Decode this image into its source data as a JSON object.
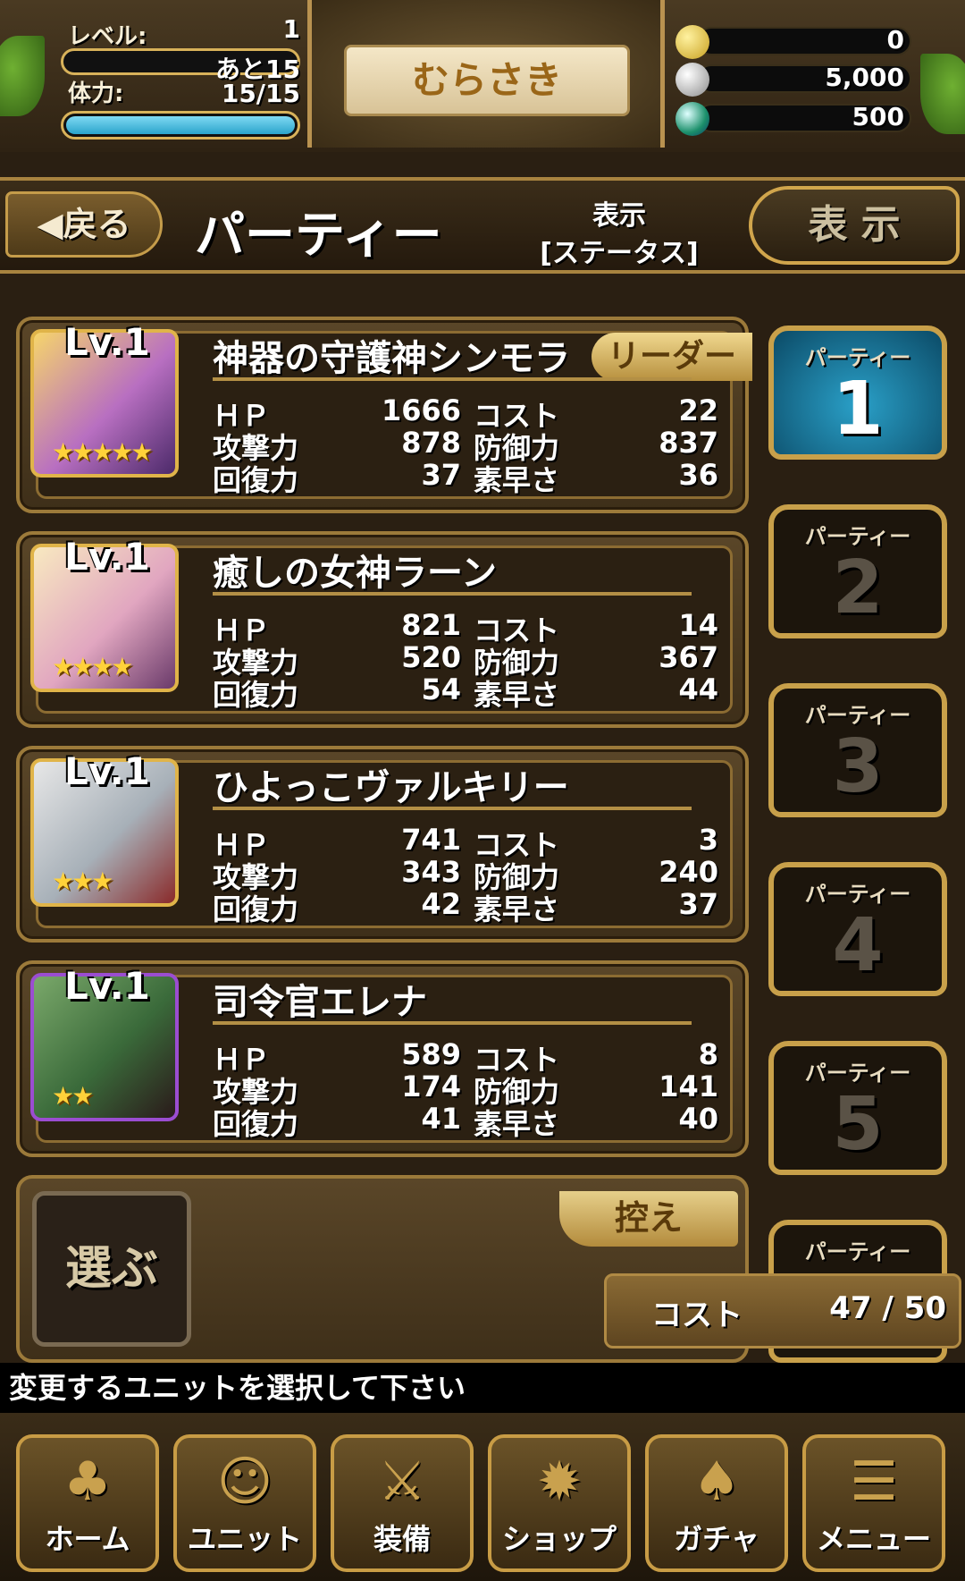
{
  "header": {
    "level_label": "レベル:",
    "level_value": "1",
    "exp_remaining": "あと15",
    "stamina_label": "体力:",
    "stamina_value": "15/15",
    "stamina_fraction": 1.0,
    "player_name": "むらさき",
    "currencies": [
      {
        "icon": "gold-coin-icon",
        "value": "0"
      },
      {
        "icon": "silver-coin-icon",
        "value": "5,000"
      },
      {
        "icon": "orb-icon",
        "value": "500"
      }
    ]
  },
  "titlebar": {
    "back_label": "◀戻る",
    "title": "パーティー",
    "display_mode_label": "表示",
    "display_mode_value": "[ステータス]",
    "display_button_label": "表 示"
  },
  "units": [
    {
      "level": "Lv.1",
      "name": "神器の守護神シンモラ",
      "badge": "リーダー",
      "stars": "★★★★★",
      "hp": "1666",
      "cost": "22",
      "atk": "878",
      "def": "837",
      "rec": "37",
      "spd": "36"
    },
    {
      "level": "Lv.1",
      "name": "癒しの女神ラーン",
      "badge": "",
      "stars": "★★★★",
      "hp": "821",
      "cost": "14",
      "atk": "520",
      "def": "367",
      "rec": "54",
      "spd": "44"
    },
    {
      "level": "Lv.1",
      "name": "ひよっこヴァルキリー",
      "badge": "",
      "stars": "★★★",
      "hp": "741",
      "cost": "3",
      "atk": "343",
      "def": "240",
      "rec": "42",
      "spd": "37"
    },
    {
      "level": "Lv.1",
      "name": "司令官エレナ",
      "badge": "",
      "stars": "★★",
      "hp": "589",
      "cost": "8",
      "atk": "174",
      "def": "141",
      "rec": "41",
      "spd": "40"
    }
  ],
  "stat_labels": {
    "hp": "ＨＰ",
    "atk": "攻撃力",
    "rec": "回復力",
    "cost": "コスト",
    "def": "防御力",
    "spd": "素早さ"
  },
  "reserve": {
    "select_label": "選ぶ",
    "reserve_label": "控え",
    "cost_label": "コスト",
    "cost_value": "47 / 50"
  },
  "party_tabs": [
    {
      "label": "パーティー",
      "number": "1"
    },
    {
      "label": "パーティー",
      "number": "2"
    },
    {
      "label": "パーティー",
      "number": "3"
    },
    {
      "label": "パーティー",
      "number": "4"
    },
    {
      "label": "パーティー",
      "number": "5"
    },
    {
      "label": "パーティー",
      "number": ""
    }
  ],
  "message": "変更するユニットを選択して下さい",
  "nav": [
    {
      "label": "ホーム",
      "icon": "home-icon"
    },
    {
      "label": "ユニット",
      "icon": "unit-icon"
    },
    {
      "label": "装備",
      "icon": "equipment-icon"
    },
    {
      "label": "ショップ",
      "icon": "shop-icon"
    },
    {
      "label": "ガチャ",
      "icon": "gacha-icon"
    },
    {
      "label": "メニュー",
      "icon": "menu-icon"
    }
  ],
  "colors": {
    "gold_border": "#c8a04a",
    "active_tab": "#1b6f8f",
    "stamina_bar": "#35b6dc"
  }
}
